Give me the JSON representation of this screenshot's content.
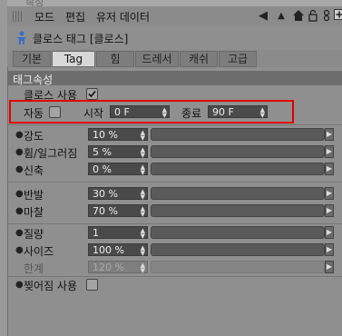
{
  "header": {
    "partial": "속성"
  },
  "menu": [
    "모드",
    "편집",
    "유저 데이터"
  ],
  "toolbar_icons": [
    "arrow-left-icon",
    "arrow-up-icon",
    "home-icon",
    "lock-icon",
    "settings-icon",
    "add-icon"
  ],
  "object_title": "클로스 태그 [클로스]",
  "tabs": [
    "기본",
    "Tag",
    "힘",
    "드레서",
    "캐쉬",
    "고급"
  ],
  "active_tab": "Tag",
  "section": "태그속성",
  "cloth_enabled": {
    "label": "클로스 사용",
    "checked": true
  },
  "auto_row": {
    "auto_label": "자동",
    "start_label": "시작",
    "start_value": "0 F",
    "end_label": "종료",
    "end_value": "90 F"
  },
  "params_group1": [
    {
      "label": "강도",
      "value": "10 %",
      "fill": 0.1
    },
    {
      "label": "휨/일그러짐",
      "value": "5 %",
      "fill": 0.05
    },
    {
      "label": "신축",
      "value": "0 %",
      "fill": 0.0
    }
  ],
  "params_group2": [
    {
      "label": "반발",
      "value": "30 %",
      "fill": 0.3
    },
    {
      "label": "마찰",
      "value": "70 %",
      "fill": 0.7
    }
  ],
  "params_group3": [
    {
      "label": "질량",
      "value": "1",
      "fill": 0.1
    },
    {
      "label": "사이즈",
      "value": "100 %",
      "fill": 1.0
    },
    {
      "label": "한계",
      "value": "120 %",
      "fill": 1.0,
      "disabled": true
    }
  ],
  "tear": {
    "label": "찢어짐 사용",
    "checked": false
  },
  "colors": {
    "highlight": "#e00000",
    "panel": "#8f8f8f"
  }
}
